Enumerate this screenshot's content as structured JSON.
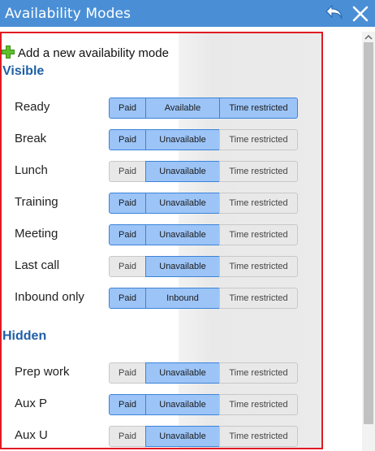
{
  "window": {
    "title": "Availability Modes"
  },
  "add_mode": {
    "label": "Add a new availability mode"
  },
  "sections": {
    "visible": {
      "title": "Visible"
    },
    "hidden": {
      "title": "Hidden"
    }
  },
  "modes": [
    {
      "name": "Ready",
      "paid_label": "Paid",
      "paid_on": true,
      "availability_label": "Available",
      "availability_on": true,
      "time_label": "Time restricted",
      "time_on": true
    },
    {
      "name": "Break",
      "paid_label": "Paid",
      "paid_on": true,
      "availability_label": "Unavailable",
      "availability_on": true,
      "time_label": "Time restricted",
      "time_on": false
    },
    {
      "name": "Lunch",
      "paid_label": "Paid",
      "paid_on": false,
      "availability_label": "Unavailable",
      "availability_on": true,
      "time_label": "Time restricted",
      "time_on": false
    },
    {
      "name": "Training",
      "paid_label": "Paid",
      "paid_on": true,
      "availability_label": "Unavailable",
      "availability_on": true,
      "time_label": "Time restricted",
      "time_on": false
    },
    {
      "name": "Meeting",
      "paid_label": "Paid",
      "paid_on": true,
      "availability_label": "Unavailable",
      "availability_on": true,
      "time_label": "Time restricted",
      "time_on": false
    },
    {
      "name": "Last call",
      "paid_label": "Paid",
      "paid_on": false,
      "availability_label": "Unavailable",
      "availability_on": true,
      "time_label": "Time restricted",
      "time_on": false
    },
    {
      "name": "Inbound only",
      "paid_label": "Paid",
      "paid_on": true,
      "availability_label": "Inbound",
      "availability_on": true,
      "time_label": "Time restricted",
      "time_on": false
    },
    {
      "name": "Prep work",
      "paid_label": "Paid",
      "paid_on": false,
      "availability_label": "Unavailable",
      "availability_on": true,
      "time_label": "Time restricted",
      "time_on": false
    },
    {
      "name": "Aux P",
      "paid_label": "Paid",
      "paid_on": true,
      "availability_label": "Unavailable",
      "availability_on": true,
      "time_label": "Time restricted",
      "time_on": false
    },
    {
      "name": "Aux U",
      "paid_label": "Paid",
      "paid_on": false,
      "availability_label": "Unavailable",
      "availability_on": true,
      "time_label": "Time restricted",
      "time_on": false
    }
  ],
  "icons": {
    "undo": "undo-icon",
    "close": "close-icon",
    "add": "plus-icon"
  },
  "colors": {
    "titlebar": "#4a8fd6",
    "selected_fill": "#9cc4f7",
    "selected_border": "#3b83d8",
    "section_title": "#1f5fa6",
    "highlight_border": "#e01b24",
    "add_icon": "#5fbf2a"
  }
}
